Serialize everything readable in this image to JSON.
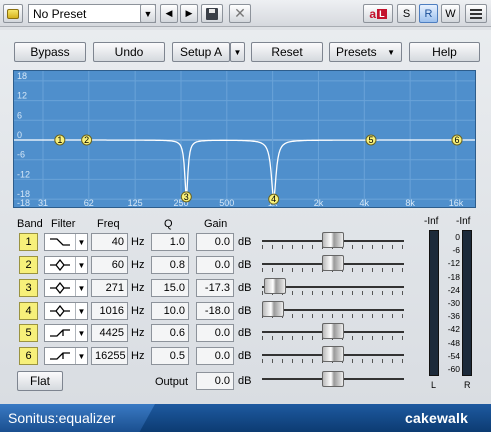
{
  "host": {
    "preset": "No Preset",
    "buttons": {
      "a_label": "a",
      "l_label": "L",
      "s_label": "S",
      "r_label": "R",
      "w_label": "W"
    }
  },
  "toolbar": {
    "bypass": "Bypass",
    "undo": "Undo",
    "setup": "Setup A",
    "reset": "Reset",
    "presets": "Presets",
    "help": "Help"
  },
  "graph": {
    "freq_ticks": [
      "31",
      "62",
      "125",
      "250",
      "500",
      "1k",
      "2k",
      "4k",
      "8k",
      "16k"
    ],
    "db_ticks": [
      "18",
      "12",
      "6",
      "0",
      "-6",
      "-12",
      "-18"
    ],
    "nodes": [
      "1",
      "2",
      "3",
      "4",
      "5",
      "6"
    ]
  },
  "headers": {
    "band": "Band",
    "filter": "Filter",
    "freq": "Freq",
    "q": "Q",
    "gain": "Gain"
  },
  "units": {
    "hz": "Hz",
    "db": "dB"
  },
  "bands": [
    {
      "num": "1",
      "filter": "low-shelf",
      "freq": "40",
      "q": "1.0",
      "gain": "0.0",
      "level": 0.5
    },
    {
      "num": "2",
      "filter": "peak",
      "freq": "60",
      "q": "0.8",
      "gain": "0.0",
      "level": 0.5
    },
    {
      "num": "3",
      "filter": "peak",
      "freq": "271",
      "q": "15.0",
      "gain": "-17.3",
      "level": 0.02
    },
    {
      "num": "4",
      "filter": "peak",
      "freq": "1016",
      "q": "10.0",
      "gain": "-18.0",
      "level": 0.0
    },
    {
      "num": "5",
      "filter": "high-shelf",
      "freq": "4425",
      "q": "0.6",
      "gain": "0.0",
      "level": 0.5
    },
    {
      "num": "6",
      "filter": "high-shelf",
      "freq": "16255",
      "q": "0.5",
      "gain": "0.0",
      "level": 0.5
    }
  ],
  "output": {
    "label": "Output",
    "gain": "0.0",
    "level": 0.5
  },
  "flat": "Flat",
  "meters": {
    "left_top": "-Inf",
    "right_top": "-Inf",
    "scale": [
      "0",
      "-6",
      "-12",
      "-18",
      "-24",
      "-30",
      "-36",
      "-42",
      "-48",
      "-54",
      "-60"
    ],
    "left_label": "L",
    "right_label": "R"
  },
  "footer": {
    "title": "Sonitus:equalizer",
    "brand": "cakewalk"
  },
  "colors": {
    "graph_bg": "#4f8fcc",
    "band_button": "#f7f07a",
    "footer": "#1a4f8f",
    "meter_led": "#d9a23a"
  }
}
